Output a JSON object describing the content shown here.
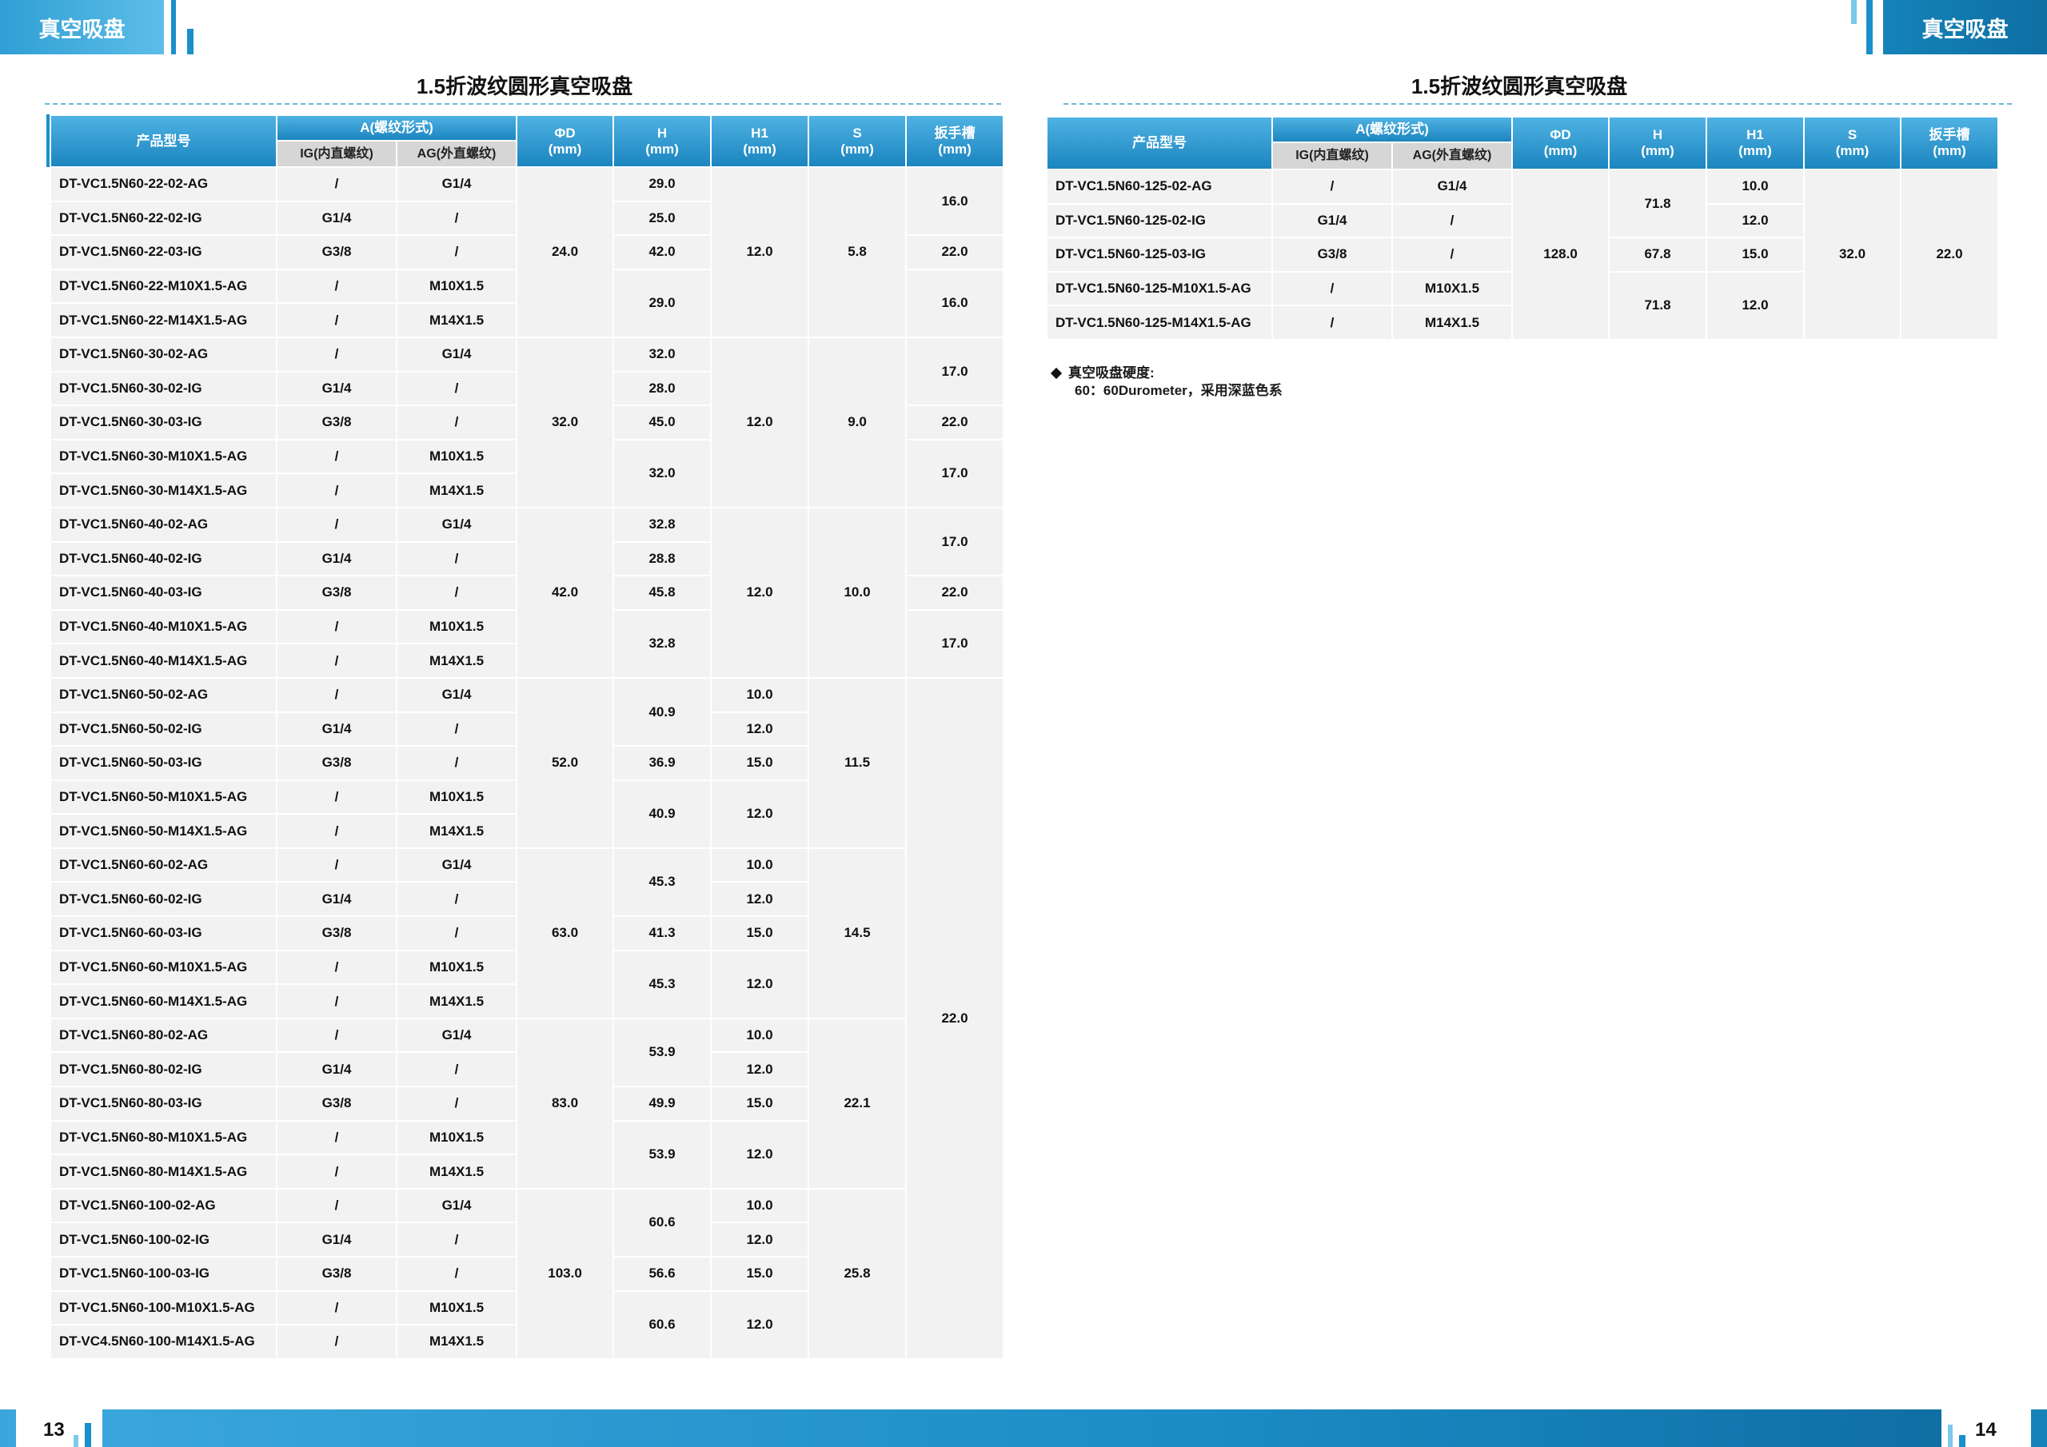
{
  "header": {
    "left_title": "真空吸盘",
    "right_title": "真空吸盘"
  },
  "left_page": {
    "title": "1.5折波纹圆形真空吸盘",
    "page_number": "13",
    "headers": {
      "model": "产品型号",
      "thread": "A(螺纹形式)",
      "ig": "IG(内直螺纹)",
      "ag": "AG(外直螺纹)",
      "phid": "ΦD\n(mm)",
      "h": "H\n(mm)",
      "h1": "H1\n(mm)",
      "s": "S\n(mm)",
      "wrench": "扳手槽\n(mm)"
    },
    "rows": [
      {
        "model": "DT-VC1.5N60-22-02-AG",
        "ig": "/",
        "ag": "G1/4"
      },
      {
        "model": "DT-VC1.5N60-22-02-IG",
        "ig": "G1/4",
        "ag": "/"
      },
      {
        "model": "DT-VC1.5N60-22-03-IG",
        "ig": "G3/8",
        "ag": "/"
      },
      {
        "model": "DT-VC1.5N60-22-M10X1.5-AG",
        "ig": "/",
        "ag": "M10X1.5"
      },
      {
        "model": "DT-VC1.5N60-22-M14X1.5-AG",
        "ig": "/",
        "ag": "M14X1.5"
      },
      {
        "model": "DT-VC1.5N60-30-02-AG",
        "ig": "/",
        "ag": "G1/4"
      },
      {
        "model": "DT-VC1.5N60-30-02-IG",
        "ig": "G1/4",
        "ag": "/"
      },
      {
        "model": "DT-VC1.5N60-30-03-IG",
        "ig": "G3/8",
        "ag": "/"
      },
      {
        "model": "DT-VC1.5N60-30-M10X1.5-AG",
        "ig": "/",
        "ag": "M10X1.5"
      },
      {
        "model": "DT-VC1.5N60-30-M14X1.5-AG",
        "ig": "/",
        "ag": "M14X1.5"
      },
      {
        "model": "DT-VC1.5N60-40-02-AG",
        "ig": "/",
        "ag": "G1/4"
      },
      {
        "model": "DT-VC1.5N60-40-02-IG",
        "ig": "G1/4",
        "ag": "/"
      },
      {
        "model": "DT-VC1.5N60-40-03-IG",
        "ig": "G3/8",
        "ag": "/"
      },
      {
        "model": "DT-VC1.5N60-40-M10X1.5-AG",
        "ig": "/",
        "ag": "M10X1.5"
      },
      {
        "model": "DT-VC1.5N60-40-M14X1.5-AG",
        "ig": "/",
        "ag": "M14X1.5"
      },
      {
        "model": "DT-VC1.5N60-50-02-AG",
        "ig": "/",
        "ag": "G1/4"
      },
      {
        "model": "DT-VC1.5N60-50-02-IG",
        "ig": "G1/4",
        "ag": "/"
      },
      {
        "model": "DT-VC1.5N60-50-03-IG",
        "ig": "G3/8",
        "ag": "/"
      },
      {
        "model": "DT-VC1.5N60-50-M10X1.5-AG",
        "ig": "/",
        "ag": "M10X1.5"
      },
      {
        "model": "DT-VC1.5N60-50-M14X1.5-AG",
        "ig": "/",
        "ag": "M14X1.5"
      },
      {
        "model": "DT-VC1.5N60-60-02-AG",
        "ig": "/",
        "ag": "G1/4"
      },
      {
        "model": "DT-VC1.5N60-60-02-IG",
        "ig": "G1/4",
        "ag": "/"
      },
      {
        "model": "DT-VC1.5N60-60-03-IG",
        "ig": "G3/8",
        "ag": "/"
      },
      {
        "model": "DT-VC1.5N60-60-M10X1.5-AG",
        "ig": "/",
        "ag": "M10X1.5"
      },
      {
        "model": "DT-VC1.5N60-60-M14X1.5-AG",
        "ig": "/",
        "ag": "M14X1.5"
      },
      {
        "model": "DT-VC1.5N60-80-02-AG",
        "ig": "/",
        "ag": "G1/4"
      },
      {
        "model": "DT-VC1.5N60-80-02-IG",
        "ig": "G1/4",
        "ag": "/"
      },
      {
        "model": "DT-VC1.5N60-80-03-IG",
        "ig": "G3/8",
        "ag": "/"
      },
      {
        "model": "DT-VC1.5N60-80-M10X1.5-AG",
        "ig": "/",
        "ag": "M10X1.5"
      },
      {
        "model": "DT-VC1.5N60-80-M14X1.5-AG",
        "ig": "/",
        "ag": "M14X1.5"
      },
      {
        "model": "DT-VC1.5N60-100-02-AG",
        "ig": "/",
        "ag": "G1/4"
      },
      {
        "model": "DT-VC1.5N60-100-02-IG",
        "ig": "G1/4",
        "ag": "/"
      },
      {
        "model": "DT-VC1.5N60-100-03-IG",
        "ig": "G3/8",
        "ag": "/"
      },
      {
        "model": "DT-VC1.5N60-100-M10X1.5-AG",
        "ig": "/",
        "ag": "M10X1.5"
      },
      {
        "model": "DT-VC4.5N60-100-M14X1.5-AG",
        "ig": "/",
        "ag": "M14X1.5"
      }
    ],
    "phid": [
      {
        "start": 0,
        "span": 5,
        "value": "24.0"
      },
      {
        "start": 5,
        "span": 5,
        "value": "32.0"
      },
      {
        "start": 10,
        "span": 5,
        "value": "42.0"
      },
      {
        "start": 15,
        "span": 5,
        "value": "52.0"
      },
      {
        "start": 20,
        "span": 5,
        "value": "63.0"
      },
      {
        "start": 25,
        "span": 5,
        "value": "83.0"
      },
      {
        "start": 30,
        "span": 5,
        "value": "103.0"
      }
    ],
    "h": [
      {
        "start": 0,
        "span": 1,
        "value": "29.0"
      },
      {
        "start": 1,
        "span": 1,
        "value": "25.0"
      },
      {
        "start": 2,
        "span": 1,
        "value": "42.0"
      },
      {
        "start": 3,
        "span": 2,
        "value": "29.0"
      },
      {
        "start": 5,
        "span": 1,
        "value": "32.0"
      },
      {
        "start": 6,
        "span": 1,
        "value": "28.0"
      },
      {
        "start": 7,
        "span": 1,
        "value": "45.0"
      },
      {
        "start": 8,
        "span": 2,
        "value": "32.0"
      },
      {
        "start": 10,
        "span": 1,
        "value": "32.8"
      },
      {
        "start": 11,
        "span": 1,
        "value": "28.8"
      },
      {
        "start": 12,
        "span": 1,
        "value": "45.8"
      },
      {
        "start": 13,
        "span": 2,
        "value": "32.8"
      },
      {
        "start": 15,
        "span": 2,
        "value": "40.9"
      },
      {
        "start": 17,
        "span": 1,
        "value": "36.9"
      },
      {
        "start": 18,
        "span": 2,
        "value": "40.9"
      },
      {
        "start": 20,
        "span": 2,
        "value": "45.3"
      },
      {
        "start": 22,
        "span": 1,
        "value": "41.3"
      },
      {
        "start": 23,
        "span": 2,
        "value": "45.3"
      },
      {
        "start": 25,
        "span": 2,
        "value": "53.9"
      },
      {
        "start": 27,
        "span": 1,
        "value": "49.9"
      },
      {
        "start": 28,
        "span": 2,
        "value": "53.9"
      },
      {
        "start": 30,
        "span": 2,
        "value": "60.6"
      },
      {
        "start": 32,
        "span": 1,
        "value": "56.6"
      },
      {
        "start": 33,
        "span": 2,
        "value": "60.6"
      }
    ],
    "h1": [
      {
        "start": 0,
        "span": 5,
        "value": "12.0"
      },
      {
        "start": 5,
        "span": 5,
        "value": "12.0"
      },
      {
        "start": 10,
        "span": 5,
        "value": "12.0"
      },
      {
        "start": 15,
        "span": 1,
        "value": "10.0"
      },
      {
        "start": 16,
        "span": 1,
        "value": "12.0"
      },
      {
        "start": 17,
        "span": 1,
        "value": "15.0"
      },
      {
        "start": 18,
        "span": 2,
        "value": "12.0"
      },
      {
        "start": 20,
        "span": 1,
        "value": "10.0"
      },
      {
        "start": 21,
        "span": 1,
        "value": "12.0"
      },
      {
        "start": 22,
        "span": 1,
        "value": "15.0"
      },
      {
        "start": 23,
        "span": 2,
        "value": "12.0"
      },
      {
        "start": 25,
        "span": 1,
        "value": "10.0"
      },
      {
        "start": 26,
        "span": 1,
        "value": "12.0"
      },
      {
        "start": 27,
        "span": 1,
        "value": "15.0"
      },
      {
        "start": 28,
        "span": 2,
        "value": "12.0"
      },
      {
        "start": 30,
        "span": 1,
        "value": "10.0"
      },
      {
        "start": 31,
        "span": 1,
        "value": "12.0"
      },
      {
        "start": 32,
        "span": 1,
        "value": "15.0"
      },
      {
        "start": 33,
        "span": 2,
        "value": "12.0"
      }
    ],
    "s": [
      {
        "start": 0,
        "span": 5,
        "value": "5.8"
      },
      {
        "start": 5,
        "span": 5,
        "value": "9.0"
      },
      {
        "start": 10,
        "span": 5,
        "value": "10.0"
      },
      {
        "start": 15,
        "span": 5,
        "value": "11.5"
      },
      {
        "start": 20,
        "span": 5,
        "value": "14.5"
      },
      {
        "start": 25,
        "span": 5,
        "value": "22.1"
      },
      {
        "start": 30,
        "span": 5,
        "value": "25.8"
      }
    ],
    "wrench": [
      {
        "start": 0,
        "span": 2,
        "value": "16.0"
      },
      {
        "start": 2,
        "span": 1,
        "value": "22.0"
      },
      {
        "start": 3,
        "span": 2,
        "value": "16.0"
      },
      {
        "start": 5,
        "span": 2,
        "value": "17.0"
      },
      {
        "start": 7,
        "span": 1,
        "value": "22.0"
      },
      {
        "start": 8,
        "span": 2,
        "value": "17.0"
      },
      {
        "start": 10,
        "span": 2,
        "value": "17.0"
      },
      {
        "start": 12,
        "span": 1,
        "value": "22.0"
      },
      {
        "start": 13,
        "span": 2,
        "value": "17.0"
      },
      {
        "start": 15,
        "span": 20,
        "value": "22.0"
      }
    ]
  },
  "right_page": {
    "title": "1.5折波纹圆形真空吸盘",
    "page_number": "14",
    "headers": {
      "model": "产品型号",
      "thread": "A(螺纹形式)",
      "ig": "IG(内直螺纹)",
      "ag": "AG(外直螺纹)",
      "phid": "ΦD\n(mm)",
      "h": "H\n(mm)",
      "h1": "H1\n(mm)",
      "s": "S\n(mm)",
      "wrench": "扳手槽\n(mm)"
    },
    "rows": [
      {
        "model": "DT-VC1.5N60-125-02-AG",
        "ig": "/",
        "ag": "G1/4"
      },
      {
        "model": "DT-VC1.5N60-125-02-IG",
        "ig": "G1/4",
        "ag": "/"
      },
      {
        "model": "DT-VC1.5N60-125-03-IG",
        "ig": "G3/8",
        "ag": "/"
      },
      {
        "model": "DT-VC1.5N60-125-M10X1.5-AG",
        "ig": "/",
        "ag": "M10X1.5"
      },
      {
        "model": "DT-VC1.5N60-125-M14X1.5-AG",
        "ig": "/",
        "ag": "M14X1.5"
      }
    ],
    "phid": [
      {
        "start": 0,
        "span": 5,
        "value": "128.0"
      }
    ],
    "h": [
      {
        "start": 0,
        "span": 2,
        "value": "71.8"
      },
      {
        "start": 2,
        "span": 1,
        "value": "67.8"
      },
      {
        "start": 3,
        "span": 2,
        "value": "71.8"
      }
    ],
    "h1": [
      {
        "start": 0,
        "span": 1,
        "value": "10.0"
      },
      {
        "start": 1,
        "span": 1,
        "value": "12.0"
      },
      {
        "start": 2,
        "span": 1,
        "value": "15.0"
      },
      {
        "start": 3,
        "span": 2,
        "value": "12.0"
      }
    ],
    "s": [
      {
        "start": 0,
        "span": 5,
        "value": "32.0"
      }
    ],
    "wrench": [
      {
        "start": 0,
        "span": 5,
        "value": "22.0"
      }
    ],
    "note": {
      "title": "真空吸盘硬度:",
      "text": "60：60Durometer，采用深蓝色系"
    }
  }
}
